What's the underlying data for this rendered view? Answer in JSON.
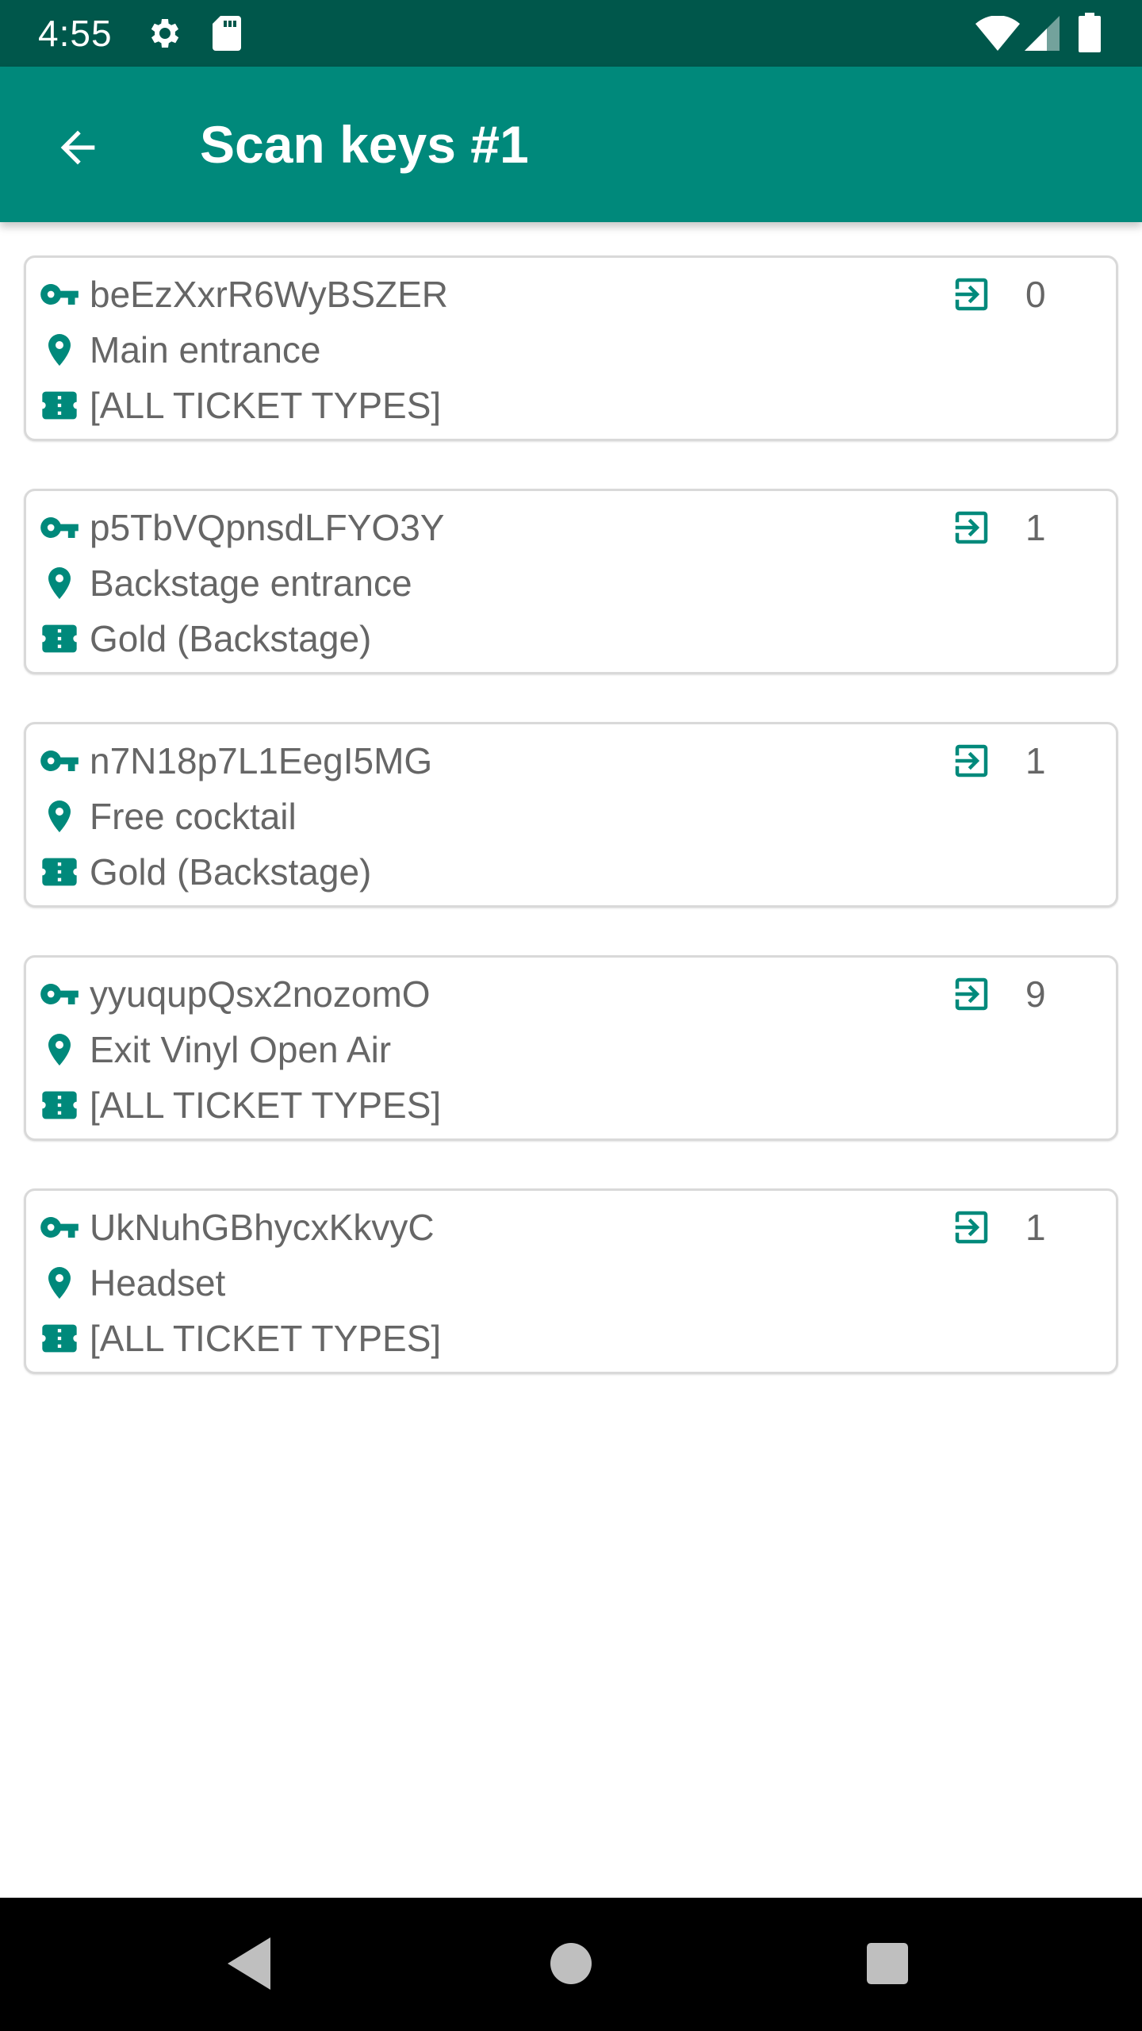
{
  "status_bar": {
    "time": "4:55",
    "icons": [
      "gear-icon",
      "sd-card-icon",
      "wifi-icon",
      "cell-signal-icon",
      "battery-icon"
    ]
  },
  "app_bar": {
    "title": "Scan keys #1",
    "back_icon": "arrow-back-icon"
  },
  "colors": {
    "status_bar": "#00574b",
    "app_bar": "#00897b",
    "accent": "#00897b",
    "text_secondary": "#666666",
    "card_border": "#d9d9d9"
  },
  "scan_keys": [
    {
      "key": "beEzXxrR6WyBSZER",
      "location": "Main entrance",
      "ticket_types": "[ALL TICKET TYPES]",
      "checkins": "0"
    },
    {
      "key": "p5TbVQpnsdLFYO3Y",
      "location": "Backstage entrance",
      "ticket_types": "Gold (Backstage)",
      "checkins": "1"
    },
    {
      "key": "n7N18p7L1EegI5MG",
      "location": "Free cocktail",
      "ticket_types": "Gold (Backstage)",
      "checkins": "1"
    },
    {
      "key": "yyuqupQsx2nozomO",
      "location": "Exit Vinyl Open Air",
      "ticket_types": "[ALL TICKET TYPES]",
      "checkins": "9"
    },
    {
      "key": "UkNuhGBhycxKkvyC",
      "location": "Headset",
      "ticket_types": "[ALL TICKET TYPES]",
      "checkins": "1"
    }
  ],
  "nav_bar": {
    "buttons": [
      "back-triangle-icon",
      "home-circle-icon",
      "recents-square-icon"
    ]
  }
}
